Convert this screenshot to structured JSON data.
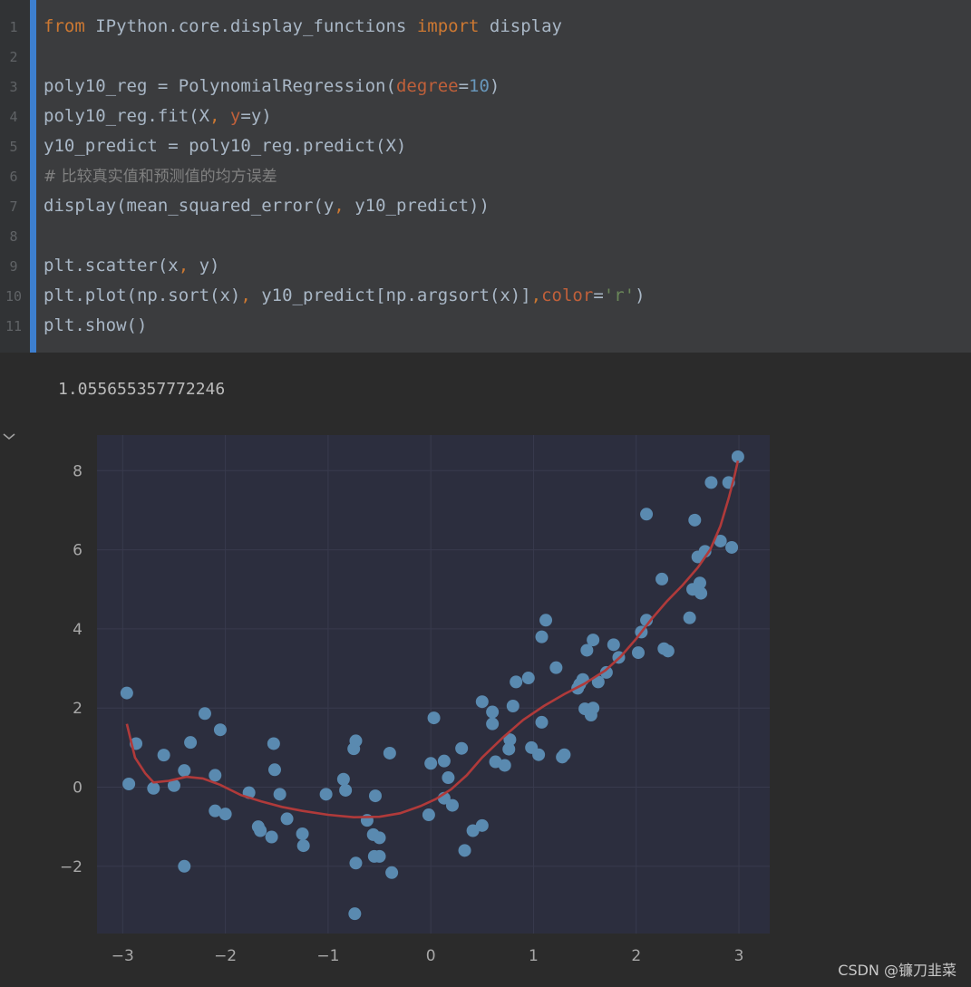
{
  "code_cell": {
    "line_numbers": [
      "1",
      "2",
      "3",
      "4",
      "5",
      "6",
      "7",
      "8",
      "9",
      "10",
      "11"
    ],
    "lines": {
      "l1": {
        "kw_from": "from",
        "module": " IPython.core.display_functions ",
        "kw_import": "import",
        "name": " display"
      },
      "l3": {
        "a": "poly10_reg = PolynomialRegression(",
        "param": "degree",
        "eq": "=",
        "num": "10",
        "b": ")"
      },
      "l4": {
        "a": "poly10_reg.fit(X",
        "comma": ", ",
        "param": "y",
        "b": "=y)"
      },
      "l5": {
        "text": "y10_predict = poly10_reg.predict(X)"
      },
      "l6": {
        "comment": "# 比较真实值和预测值的均方误差"
      },
      "l7": {
        "a": "display(mean_squared_error(y",
        "comma": ", ",
        "b": "y10_predict))"
      },
      "l9": {
        "a": "plt.scatter(x",
        "comma": ", ",
        "b": "y)"
      },
      "l10": {
        "a": "plt.plot(np.sort(x)",
        "comma": ", ",
        "b": "y10_predict[np.argsort(x)]",
        "comma2": ",",
        "param": "color",
        "eq": "=",
        "str": "'r'",
        "c": ")"
      },
      "l11": {
        "text": "plt.show()"
      }
    }
  },
  "output": {
    "mse_value": "1.055655357772246"
  },
  "icons": {
    "collapse": "chevron-down-icon"
  },
  "colors": {
    "plot_bg": "#2c2e3e",
    "point": "#5a8ab0",
    "line": "#b03a3a",
    "grid": "#383a4d",
    "tick": "#a8a8a8",
    "accent": "#3d7fcf"
  },
  "chart_data": {
    "type": "scatter",
    "xlim": [
      -3.25,
      3.3
    ],
    "ylim": [
      -3.7,
      8.9
    ],
    "xticks": [
      -3,
      -2,
      -1,
      0,
      1,
      2,
      3
    ],
    "yticks": [
      -2,
      0,
      2,
      4,
      6,
      8
    ],
    "xtick_labels": [
      "−3",
      "−2",
      "−1",
      "0",
      "1",
      "2",
      "3"
    ],
    "ytick_labels": [
      "−2",
      "0",
      "2",
      "4",
      "6",
      "8"
    ],
    "grid": true,
    "scatter": [
      [
        -2.96,
        2.38
      ],
      [
        -2.94,
        0.08
      ],
      [
        -2.87,
        1.1
      ],
      [
        -2.7,
        -0.03
      ],
      [
        -2.6,
        0.81
      ],
      [
        -2.5,
        0.04
      ],
      [
        -2.4,
        0.42
      ],
      [
        -2.4,
        -2.0
      ],
      [
        -2.34,
        1.13
      ],
      [
        -2.2,
        1.86
      ],
      [
        -2.1,
        0.3
      ],
      [
        -2.1,
        -0.6
      ],
      [
        -2.05,
        1.45
      ],
      [
        -2.0,
        -0.68
      ],
      [
        -1.77,
        -0.14
      ],
      [
        -1.68,
        -1.0
      ],
      [
        -1.66,
        -1.1
      ],
      [
        -1.55,
        -1.26
      ],
      [
        -1.53,
        1.1
      ],
      [
        -1.52,
        0.44
      ],
      [
        -1.47,
        -0.18
      ],
      [
        -1.4,
        -0.8
      ],
      [
        -1.25,
        -1.18
      ],
      [
        -1.24,
        -1.48
      ],
      [
        -1.02,
        -0.18
      ],
      [
        -0.85,
        0.2
      ],
      [
        -0.83,
        -0.08
      ],
      [
        -0.75,
        0.97
      ],
      [
        -0.73,
        1.17
      ],
      [
        -0.73,
        -1.92
      ],
      [
        -0.74,
        -3.2
      ],
      [
        -0.62,
        -0.84
      ],
      [
        -0.56,
        -1.2
      ],
      [
        -0.55,
        -1.75
      ],
      [
        -0.54,
        -0.22
      ],
      [
        -0.5,
        -1.28
      ],
      [
        -0.5,
        -1.75
      ],
      [
        -0.4,
        0.86
      ],
      [
        -0.38,
        -2.16
      ],
      [
        -0.02,
        -0.7
      ],
      [
        0.0,
        0.6
      ],
      [
        0.03,
        1.75
      ],
      [
        0.13,
        -0.28
      ],
      [
        0.13,
        0.66
      ],
      [
        0.17,
        0.24
      ],
      [
        0.21,
        -0.46
      ],
      [
        0.3,
        0.98
      ],
      [
        0.33,
        -1.6
      ],
      [
        0.41,
        -1.1
      ],
      [
        0.5,
        -0.97
      ],
      [
        0.5,
        2.16
      ],
      [
        0.6,
        1.6
      ],
      [
        0.6,
        1.9
      ],
      [
        0.63,
        0.64
      ],
      [
        0.72,
        0.55
      ],
      [
        0.76,
        0.96
      ],
      [
        0.77,
        1.2
      ],
      [
        0.8,
        2.05
      ],
      [
        0.83,
        2.66
      ],
      [
        0.95,
        2.76
      ],
      [
        0.98,
        1.0
      ],
      [
        1.05,
        0.82
      ],
      [
        1.08,
        1.64
      ],
      [
        1.08,
        3.8
      ],
      [
        1.12,
        4.22
      ],
      [
        1.22,
        3.02
      ],
      [
        1.28,
        0.76
      ],
      [
        1.3,
        0.82
      ],
      [
        1.43,
        2.5
      ],
      [
        1.45,
        2.6
      ],
      [
        1.48,
        2.72
      ],
      [
        1.5,
        1.98
      ],
      [
        1.52,
        3.46
      ],
      [
        1.56,
        1.82
      ],
      [
        1.58,
        2.0
      ],
      [
        1.58,
        3.72
      ],
      [
        1.63,
        2.66
      ],
      [
        1.71,
        2.9
      ],
      [
        1.78,
        3.6
      ],
      [
        1.83,
        3.28
      ],
      [
        2.02,
        3.4
      ],
      [
        2.05,
        3.92
      ],
      [
        2.1,
        4.22
      ],
      [
        2.1,
        6.9
      ],
      [
        2.25,
        5.26
      ],
      [
        2.27,
        3.5
      ],
      [
        2.31,
        3.44
      ],
      [
        2.52,
        4.28
      ],
      [
        2.55,
        5.0
      ],
      [
        2.57,
        6.75
      ],
      [
        2.6,
        5.82
      ],
      [
        2.62,
        5.16
      ],
      [
        2.63,
        4.9
      ],
      [
        2.67,
        5.96
      ],
      [
        2.73,
        7.7
      ],
      [
        2.82,
        6.22
      ],
      [
        2.9,
        7.7
      ],
      [
        2.93,
        6.06
      ],
      [
        2.99,
        8.35
      ]
    ],
    "line": [
      [
        -2.96,
        1.6
      ],
      [
        -2.88,
        0.75
      ],
      [
        -2.78,
        0.35
      ],
      [
        -2.7,
        0.12
      ],
      [
        -2.55,
        0.16
      ],
      [
        -2.38,
        0.26
      ],
      [
        -2.22,
        0.22
      ],
      [
        -2.05,
        0.06
      ],
      [
        -1.85,
        -0.2
      ],
      [
        -1.65,
        -0.36
      ],
      [
        -1.45,
        -0.5
      ],
      [
        -1.25,
        -0.6
      ],
      [
        -1.0,
        -0.7
      ],
      [
        -0.75,
        -0.76
      ],
      [
        -0.5,
        -0.75
      ],
      [
        -0.3,
        -0.66
      ],
      [
        -0.1,
        -0.48
      ],
      [
        0.05,
        -0.3
      ],
      [
        0.2,
        -0.05
      ],
      [
        0.35,
        0.3
      ],
      [
        0.5,
        0.75
      ],
      [
        0.7,
        1.25
      ],
      [
        0.9,
        1.7
      ],
      [
        1.1,
        2.05
      ],
      [
        1.3,
        2.35
      ],
      [
        1.5,
        2.62
      ],
      [
        1.7,
        2.95
      ],
      [
        1.85,
        3.3
      ],
      [
        2.0,
        3.75
      ],
      [
        2.15,
        4.25
      ],
      [
        2.3,
        4.7
      ],
      [
        2.45,
        5.1
      ],
      [
        2.6,
        5.55
      ],
      [
        2.72,
        6.0
      ],
      [
        2.82,
        6.6
      ],
      [
        2.9,
        7.3
      ],
      [
        2.96,
        7.9
      ],
      [
        2.99,
        8.25
      ]
    ]
  }
}
